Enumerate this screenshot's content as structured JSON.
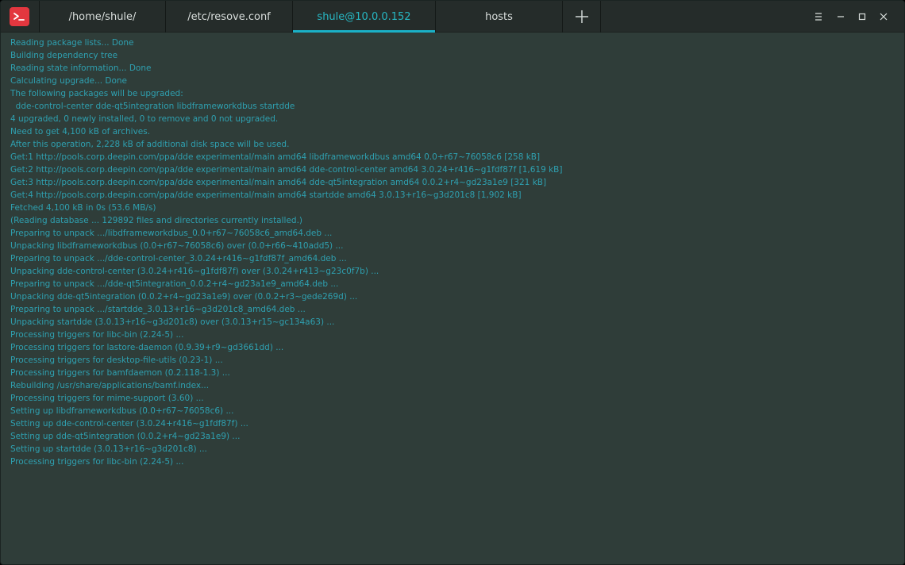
{
  "tabs": [
    {
      "label": "/home/shule/",
      "active": false
    },
    {
      "label": "/etc/resove.conf",
      "active": false
    },
    {
      "label": "shule@10.0.0.152",
      "active": true
    },
    {
      "label": "hosts",
      "active": false
    }
  ],
  "colors": {
    "accent": "#1ab1c7",
    "terminal_text": "#2fa0b0",
    "background": "#2f3d39",
    "titlebar": "#252c2a",
    "app_icon": "#e3373f"
  },
  "icons": {
    "app": "terminal-icon",
    "add_tab": "plus-icon",
    "menu": "hamburger-menu-icon",
    "minimize": "minimize-icon",
    "maximize": "maximize-icon",
    "close": "close-icon"
  },
  "terminal": {
    "lines": [
      "Reading package lists... Done",
      "Building dependency tree",
      "Reading state information... Done",
      "Calculating upgrade... Done",
      "The following packages will be upgraded:",
      "  dde-control-center dde-qt5integration libdframeworkdbus startdde",
      "4 upgraded, 0 newly installed, 0 to remove and 0 not upgraded.",
      "Need to get 4,100 kB of archives.",
      "After this operation, 2,228 kB of additional disk space will be used.",
      "Get:1 http://pools.corp.deepin.com/ppa/dde experimental/main amd64 libdframeworkdbus amd64 0.0+r67~76058c6 [258 kB]",
      "Get:2 http://pools.corp.deepin.com/ppa/dde experimental/main amd64 dde-control-center amd64 3.0.24+r416~g1fdf87f [1,619 kB]",
      "Get:3 http://pools.corp.deepin.com/ppa/dde experimental/main amd64 dde-qt5integration amd64 0.0.2+r4~gd23a1e9 [321 kB]",
      "Get:4 http://pools.corp.deepin.com/ppa/dde experimental/main amd64 startdde amd64 3.0.13+r16~g3d201c8 [1,902 kB]",
      "Fetched 4,100 kB in 0s (53.6 MB/s)",
      "(Reading database ... 129892 files and directories currently installed.)",
      "Preparing to unpack .../libdframeworkdbus_0.0+r67~76058c6_amd64.deb ...",
      "Unpacking libdframeworkdbus (0.0+r67~76058c6) over (0.0+r66~410add5) ...",
      "Preparing to unpack .../dde-control-center_3.0.24+r416~g1fdf87f_amd64.deb ...",
      "Unpacking dde-control-center (3.0.24+r416~g1fdf87f) over (3.0.24+r413~g23c0f7b) ...",
      "Preparing to unpack .../dde-qt5integration_0.0.2+r4~gd23a1e9_amd64.deb ...",
      "Unpacking dde-qt5integration (0.0.2+r4~gd23a1e9) over (0.0.2+r3~gede269d) ...",
      "Preparing to unpack .../startdde_3.0.13+r16~g3d201c8_amd64.deb ...",
      "Unpacking startdde (3.0.13+r16~g3d201c8) over (3.0.13+r15~gc134a63) ...",
      "Processing triggers for libc-bin (2.24-5) ...",
      "Processing triggers for lastore-daemon (0.9.39+r9~gd3661dd) ...",
      "Processing triggers for desktop-file-utils (0.23-1) ...",
      "Processing triggers for bamfdaemon (0.2.118-1.3) ...",
      "Rebuilding /usr/share/applications/bamf.index...",
      "Processing triggers for mime-support (3.60) ...",
      "Setting up libdframeworkdbus (0.0+r67~76058c6) ...",
      "Setting up dde-control-center (3.0.24+r416~g1fdf87f) ...",
      "Setting up dde-qt5integration (0.0.2+r4~gd23a1e9) ...",
      "Setting up startdde (3.0.13+r16~g3d201c8) ...",
      "Processing triggers for libc-bin (2.24-5) ..."
    ]
  }
}
